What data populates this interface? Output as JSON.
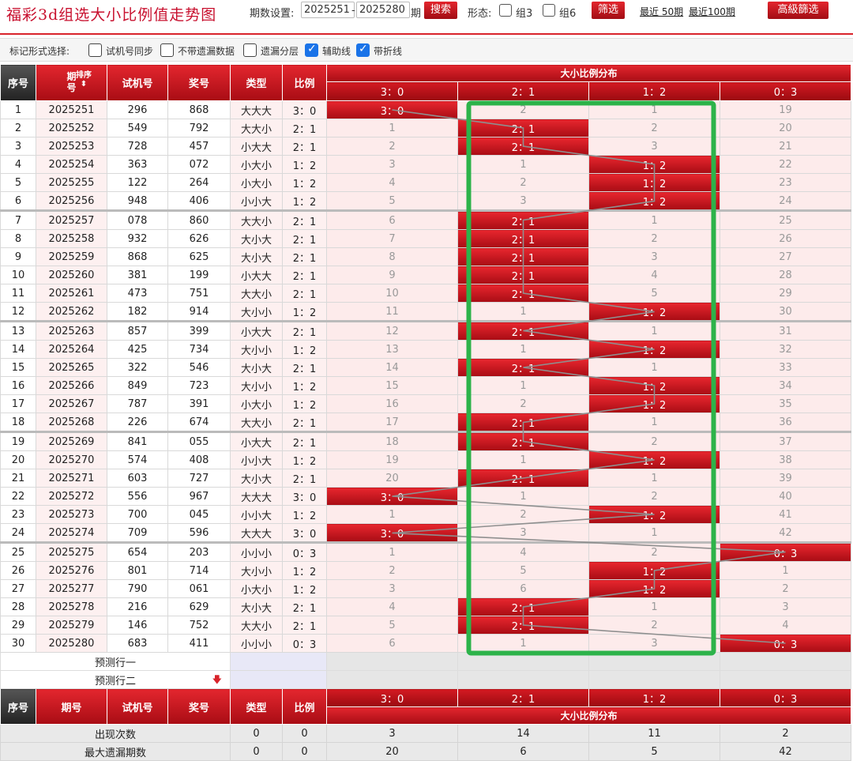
{
  "header": {
    "title": "福彩3d组选大小比例值走势图",
    "period_label": "期数设置:",
    "period_from": "2025251",
    "period_dash": "-",
    "period_to": "2025280",
    "period_unit": "期",
    "search_label": "搜索",
    "form_label": "形态:",
    "group3_label": "组3",
    "group6_label": "组6",
    "filter_label": "筛选",
    "recent50": "最近 50期",
    "recent100": "最近100期",
    "advanced_label": "高級篩选"
  },
  "options": {
    "label": "标记形式选择:",
    "items": [
      {
        "label": "试机号同步",
        "checked": false
      },
      {
        "label": "不带遗漏数据",
        "checked": false
      },
      {
        "label": "遗漏分层",
        "checked": false
      },
      {
        "label": "辅助线",
        "checked": true
      },
      {
        "label": "带折线",
        "checked": true
      }
    ]
  },
  "table": {
    "headers": {
      "idx": "序号",
      "issue": "期号",
      "sort": "排序",
      "trial": "试机号",
      "win": "奖号",
      "type": "类型",
      "ratio": "比例",
      "dist": "大小比例分布"
    },
    "dist_cols": [
      "3：0",
      "2：1",
      "1：2",
      "0：3"
    ],
    "rows": [
      {
        "idx": "1",
        "issue": "2025251",
        "trial": "296",
        "win": "868",
        "type": "大大大",
        "ratio": "3：0",
        "hit": 0,
        "dist": [
          "3：0",
          "2",
          "1",
          "19"
        ]
      },
      {
        "idx": "2",
        "issue": "2025252",
        "trial": "549",
        "win": "792",
        "type": "大大小",
        "ratio": "2：1",
        "hit": 1,
        "dist": [
          "1",
          "2：1",
          "2",
          "20"
        ]
      },
      {
        "idx": "3",
        "issue": "2025253",
        "trial": "728",
        "win": "457",
        "type": "小大大",
        "ratio": "2：1",
        "hit": 1,
        "dist": [
          "2",
          "2：1",
          "3",
          "21"
        ]
      },
      {
        "idx": "4",
        "issue": "2025254",
        "trial": "363",
        "win": "072",
        "type": "小大小",
        "ratio": "1：2",
        "hit": 2,
        "dist": [
          "3",
          "1",
          "1：2",
          "22"
        ]
      },
      {
        "idx": "5",
        "issue": "2025255",
        "trial": "122",
        "win": "264",
        "type": "小大小",
        "ratio": "1：2",
        "hit": 2,
        "dist": [
          "4",
          "2",
          "1：2",
          "23"
        ]
      },
      {
        "idx": "6",
        "issue": "2025256",
        "trial": "948",
        "win": "406",
        "type": "小小大",
        "ratio": "1：2",
        "hit": 2,
        "dist": [
          "5",
          "3",
          "1：2",
          "24"
        ]
      },
      {
        "idx": "7",
        "issue": "2025257",
        "trial": "078",
        "win": "860",
        "type": "大大小",
        "ratio": "2：1",
        "hit": 1,
        "dist": [
          "6",
          "2：1",
          "1",
          "25"
        ]
      },
      {
        "idx": "8",
        "issue": "2025258",
        "trial": "932",
        "win": "626",
        "type": "大小大",
        "ratio": "2：1",
        "hit": 1,
        "dist": [
          "7",
          "2：1",
          "2",
          "26"
        ]
      },
      {
        "idx": "9",
        "issue": "2025259",
        "trial": "868",
        "win": "625",
        "type": "大小大",
        "ratio": "2：1",
        "hit": 1,
        "dist": [
          "8",
          "2：1",
          "3",
          "27"
        ]
      },
      {
        "idx": "10",
        "issue": "2025260",
        "trial": "381",
        "win": "199",
        "type": "小大大",
        "ratio": "2：1",
        "hit": 1,
        "dist": [
          "9",
          "2：1",
          "4",
          "28"
        ]
      },
      {
        "idx": "11",
        "issue": "2025261",
        "trial": "473",
        "win": "751",
        "type": "大大小",
        "ratio": "2：1",
        "hit": 1,
        "dist": [
          "10",
          "2：1",
          "5",
          "29"
        ]
      },
      {
        "idx": "12",
        "issue": "2025262",
        "trial": "182",
        "win": "914",
        "type": "大小小",
        "ratio": "1：2",
        "hit": 2,
        "dist": [
          "11",
          "1",
          "1：2",
          "30"
        ]
      },
      {
        "idx": "13",
        "issue": "2025263",
        "trial": "857",
        "win": "399",
        "type": "小大大",
        "ratio": "2：1",
        "hit": 1,
        "dist": [
          "12",
          "2：1",
          "1",
          "31"
        ]
      },
      {
        "idx": "14",
        "issue": "2025264",
        "trial": "425",
        "win": "734",
        "type": "大小小",
        "ratio": "1：2",
        "hit": 2,
        "dist": [
          "13",
          "1",
          "1：2",
          "32"
        ]
      },
      {
        "idx": "15",
        "issue": "2025265",
        "trial": "322",
        "win": "546",
        "type": "大小大",
        "ratio": "2：1",
        "hit": 1,
        "dist": [
          "14",
          "2：1",
          "1",
          "33"
        ]
      },
      {
        "idx": "16",
        "issue": "2025266",
        "trial": "849",
        "win": "723",
        "type": "大小小",
        "ratio": "1：2",
        "hit": 2,
        "dist": [
          "15",
          "1",
          "1：2",
          "34"
        ]
      },
      {
        "idx": "17",
        "issue": "2025267",
        "trial": "787",
        "win": "391",
        "type": "小大小",
        "ratio": "1：2",
        "hit": 2,
        "dist": [
          "16",
          "2",
          "1：2",
          "35"
        ]
      },
      {
        "idx": "18",
        "issue": "2025268",
        "trial": "226",
        "win": "674",
        "type": "大大小",
        "ratio": "2：1",
        "hit": 1,
        "dist": [
          "17",
          "2：1",
          "1",
          "36"
        ]
      },
      {
        "idx": "19",
        "issue": "2025269",
        "trial": "841",
        "win": "055",
        "type": "小大大",
        "ratio": "2：1",
        "hit": 1,
        "dist": [
          "18",
          "2：1",
          "2",
          "37"
        ]
      },
      {
        "idx": "20",
        "issue": "2025270",
        "trial": "574",
        "win": "408",
        "type": "小小大",
        "ratio": "1：2",
        "hit": 2,
        "dist": [
          "19",
          "1",
          "1：2",
          "38"
        ]
      },
      {
        "idx": "21",
        "issue": "2025271",
        "trial": "603",
        "win": "727",
        "type": "大小大",
        "ratio": "2：1",
        "hit": 1,
        "dist": [
          "20",
          "2：1",
          "1",
          "39"
        ]
      },
      {
        "idx": "22",
        "issue": "2025272",
        "trial": "556",
        "win": "967",
        "type": "大大大",
        "ratio": "3：0",
        "hit": 0,
        "dist": [
          "3：0",
          "1",
          "2",
          "40"
        ]
      },
      {
        "idx": "23",
        "issue": "2025273",
        "trial": "700",
        "win": "045",
        "type": "小小大",
        "ratio": "1：2",
        "hit": 2,
        "dist": [
          "1",
          "2",
          "1：2",
          "41"
        ]
      },
      {
        "idx": "24",
        "issue": "2025274",
        "trial": "709",
        "win": "596",
        "type": "大大大",
        "ratio": "3：0",
        "hit": 0,
        "dist": [
          "3：0",
          "3",
          "1",
          "42"
        ]
      },
      {
        "idx": "25",
        "issue": "2025275",
        "trial": "654",
        "win": "203",
        "type": "小小小",
        "ratio": "0：3",
        "hit": 3,
        "dist": [
          "1",
          "4",
          "2",
          "0：3"
        ]
      },
      {
        "idx": "26",
        "issue": "2025276",
        "trial": "801",
        "win": "714",
        "type": "大小小",
        "ratio": "1：2",
        "hit": 2,
        "dist": [
          "2",
          "5",
          "1：2",
          "1"
        ]
      },
      {
        "idx": "27",
        "issue": "2025277",
        "trial": "790",
        "win": "061",
        "type": "小大小",
        "ratio": "1：2",
        "hit": 2,
        "dist": [
          "3",
          "6",
          "1：2",
          "2"
        ]
      },
      {
        "idx": "28",
        "issue": "2025278",
        "trial": "216",
        "win": "629",
        "type": "大小大",
        "ratio": "2：1",
        "hit": 1,
        "dist": [
          "4",
          "2：1",
          "1",
          "3"
        ]
      },
      {
        "idx": "29",
        "issue": "2025279",
        "trial": "146",
        "win": "752",
        "type": "大大小",
        "ratio": "2：1",
        "hit": 1,
        "dist": [
          "5",
          "2：1",
          "2",
          "4"
        ]
      },
      {
        "idx": "30",
        "issue": "2025280",
        "trial": "683",
        "win": "411",
        "type": "小小小",
        "ratio": "0：3",
        "hit": 3,
        "dist": [
          "6",
          "1",
          "3",
          "0：3"
        ]
      }
    ],
    "predict1": "预测行一",
    "predict2": "预测行二",
    "stats": [
      {
        "label": "出现次数",
        "type": "0",
        "ratio": "0",
        "vals": [
          "3",
          "14",
          "11",
          "2"
        ]
      },
      {
        "label": "最大遗漏期数",
        "type": "0",
        "ratio": "0",
        "vals": [
          "20",
          "6",
          "5",
          "42"
        ]
      }
    ]
  },
  "colors": {
    "accent_red": "#c8102e",
    "highlight_box": "#2db34a",
    "trend_line": "#8f8f8f"
  }
}
